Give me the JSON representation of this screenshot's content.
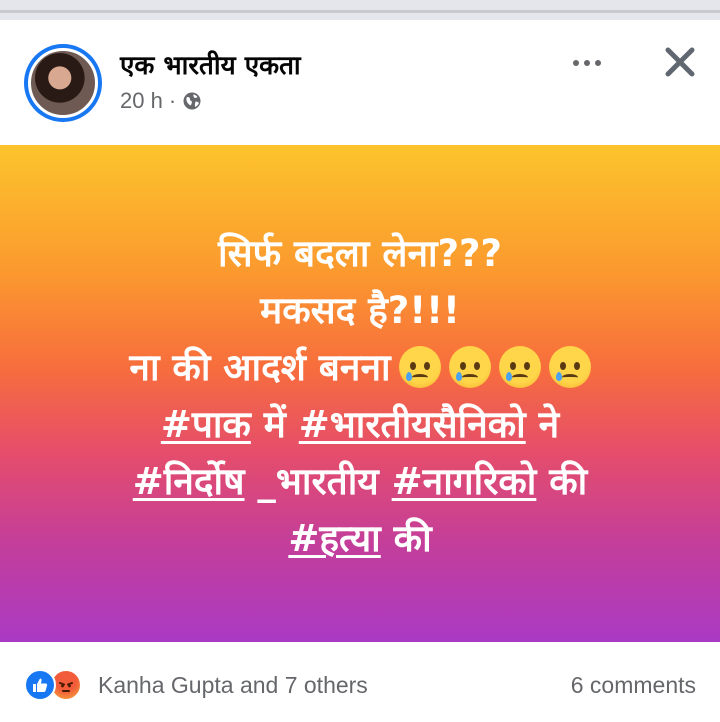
{
  "post": {
    "author": "एक भारतीय एकता",
    "time": "20 h",
    "separator": "·",
    "text_lines": [
      {
        "t": "सिर्फ बदला लेना???"
      },
      {
        "t": "मकसद है?!!!"
      },
      {
        "t": "ना की आदर्श बनना"
      },
      {
        "a": "#पाक",
        "b": " में ",
        "c": "#भारतीयसैनिको",
        "d": " ने"
      },
      {
        "a": "#निर्दोष",
        "b": " _भारतीय ",
        "c": "#नागरिको",
        "d": " की"
      },
      {
        "a": "#हत्या",
        "b": " की"
      }
    ],
    "background_gradient": [
      "#fcc42c",
      "#f76d3d",
      "#aa3ac4"
    ]
  },
  "footer": {
    "reactions_text": "Kanha Gupta and 7 others",
    "comments_text": "6 comments"
  },
  "icons": {
    "privacy": "globe-icon",
    "more": "ellipsis-icon",
    "close": "close-icon",
    "reactions": [
      "like-icon",
      "angry-icon"
    ],
    "emoji": "sad-tear-emoji"
  },
  "colors": {
    "accent": "#1877f2",
    "secondary_text": "#65676b",
    "primary_text": "#050505"
  }
}
